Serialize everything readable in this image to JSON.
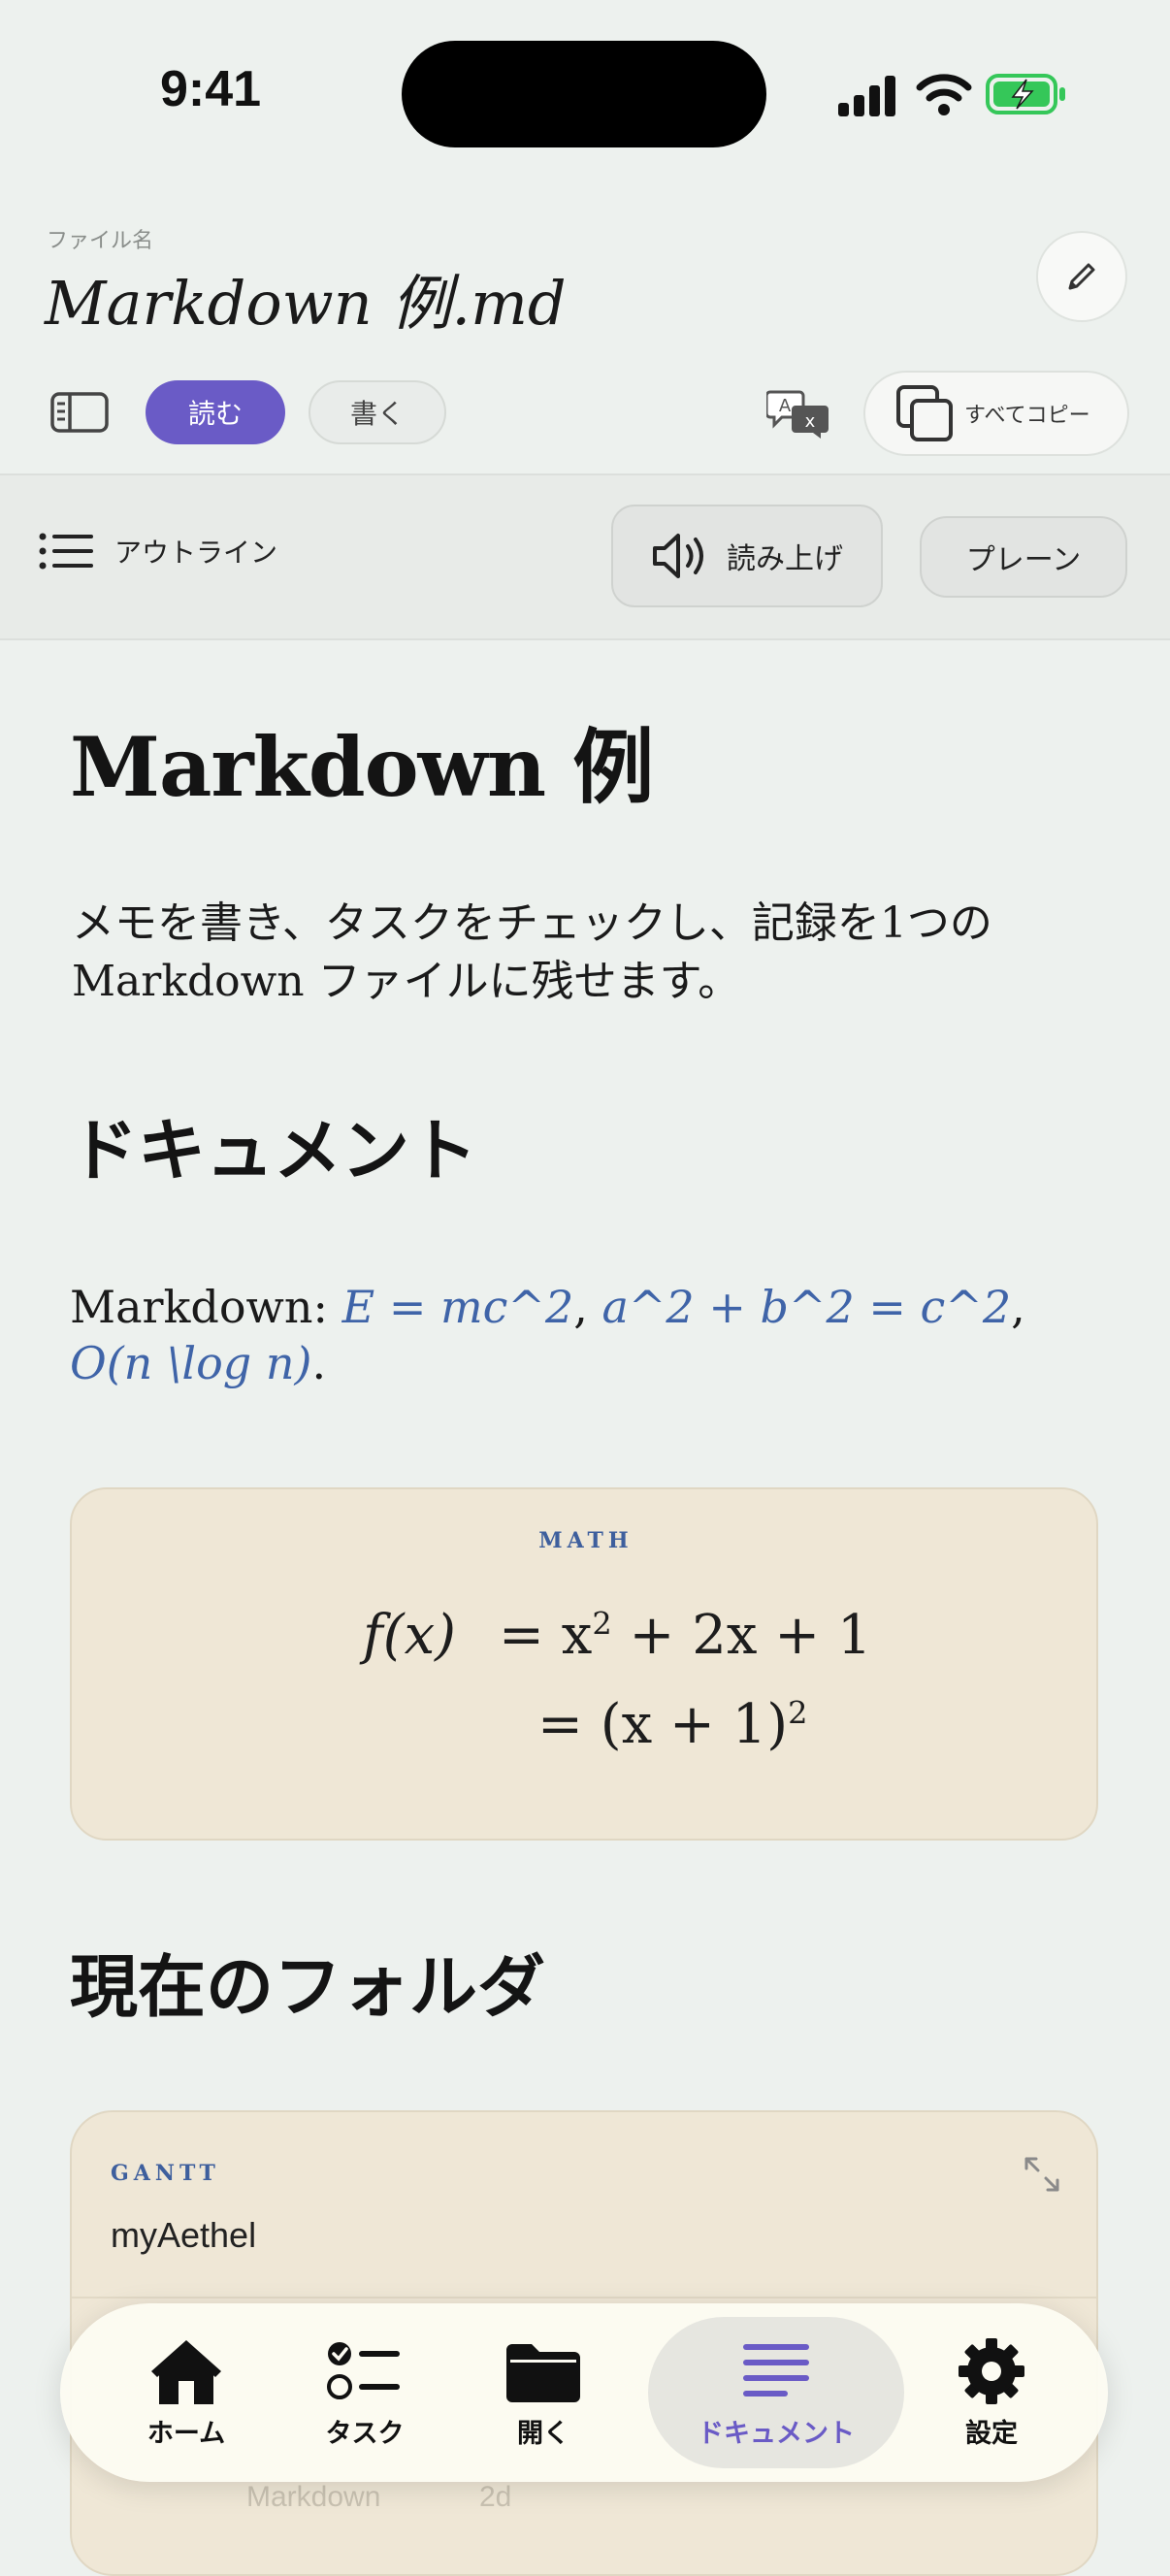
{
  "status_bar": {
    "time": "9:41"
  },
  "header": {
    "file_label": "ファイル名",
    "file_name": "Markdown 例.md"
  },
  "toolbar": {
    "read_label": "読む",
    "write_label": "書く",
    "copy_all_label": "すべてコピー"
  },
  "toolbar2": {
    "outline_label": "アウトライン",
    "read_aloud_label": "読み上げ",
    "plain_label": "プレーン"
  },
  "document": {
    "title": "Markdown 例",
    "intro_line1": "メモを書き、タスクをチェックし、記録を1つの",
    "intro_line2": "Markdown ファイルに残せます。",
    "section1_heading": "ドキュメント",
    "md_prefix": "Markdown: ",
    "math_inline_1": "E = mc^2",
    "sep1": ", ",
    "math_inline_2": "a^2 + b^2 = c^2",
    "sep2": ", ",
    "math_inline_3": "O(n \\log n)",
    "md_suffix": ".",
    "math_block": {
      "label": "MATH",
      "line1_lhs": "f(x)",
      "line1_rhs": "= x",
      "line1_rest": " + 2x + 1",
      "line2": "= (x + 1)",
      "exponent": "2"
    },
    "section2_heading": "現在のフォルダ",
    "gantt": {
      "label": "GANTT",
      "title": "myAethel",
      "faint_row_name": "Markdown",
      "faint_row_value": "2d"
    }
  },
  "tab_bar": {
    "tabs": [
      {
        "label": "ホーム",
        "icon": "house-icon",
        "active": false
      },
      {
        "label": "タスク",
        "icon": "checklist-icon",
        "active": false
      },
      {
        "label": "開く",
        "icon": "folder-icon",
        "active": false
      },
      {
        "label": "ドキュメント",
        "icon": "document-lines-icon",
        "active": true
      },
      {
        "label": "設定",
        "icon": "gear-icon",
        "active": false
      }
    ]
  },
  "colors": {
    "background": "#edf1ee",
    "accent": "#6a5bc6",
    "math_link": "#3f64a8",
    "card": "#efe7d6",
    "battery": "#35c759"
  }
}
